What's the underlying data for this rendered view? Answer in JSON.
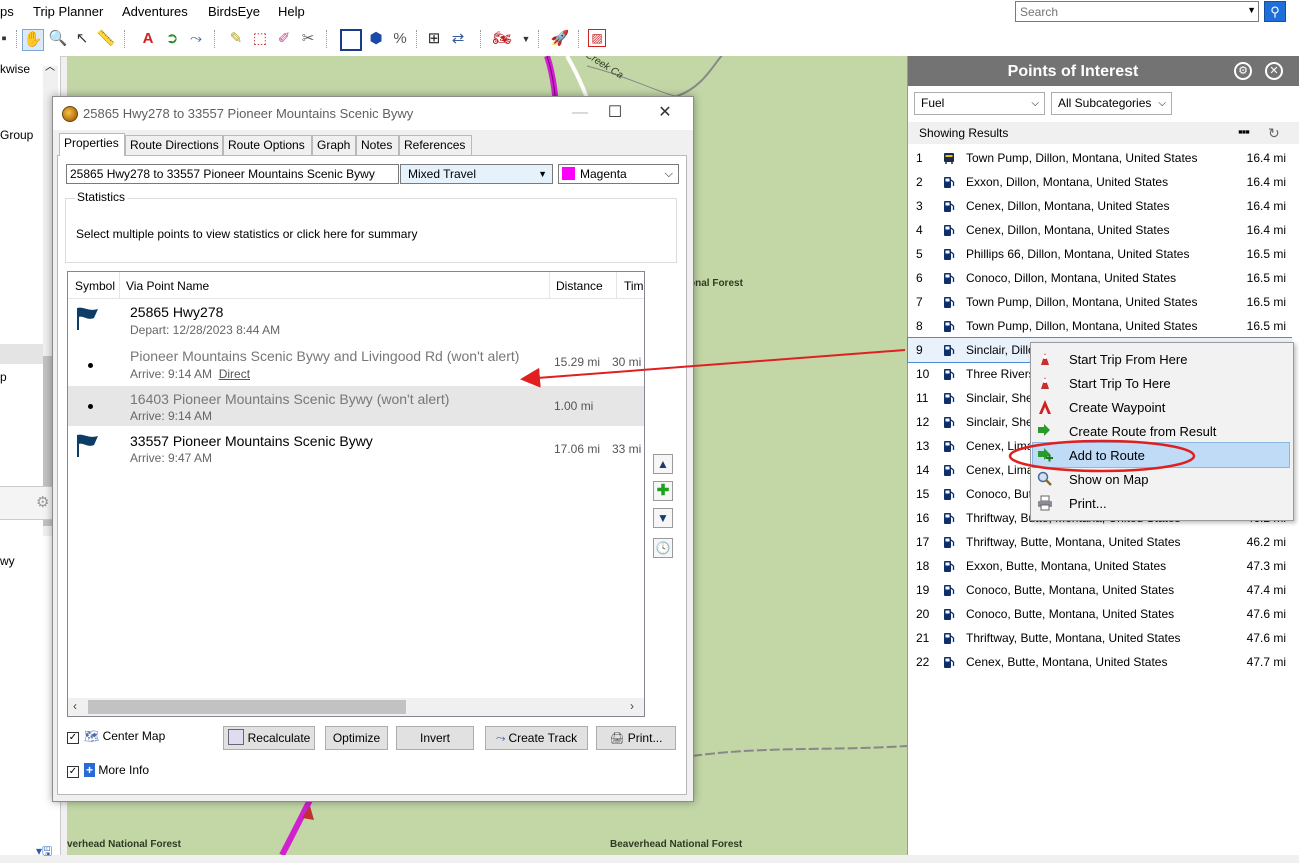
{
  "menu": {
    "items": [
      "ps",
      "Trip Planner",
      "Adventures",
      "BirdsEye",
      "Help"
    ]
  },
  "search": {
    "placeholder": "Search"
  },
  "left_panel": {
    "texts": [
      "kwise",
      "Group",
      "p",
      "wy"
    ]
  },
  "map": {
    "labels": [
      "onal Forest",
      "verhead National Forest",
      "Beaverhead National Forest",
      "Creek Ca"
    ]
  },
  "dialog": {
    "title": "25865 Hwy278 to 33557 Pioneer Mountains Scenic Bywy",
    "tabs": [
      "Properties",
      "Route Directions",
      "Route Options",
      "Graph",
      "Notes",
      "References"
    ],
    "route_name": "25865 Hwy278 to 33557 Pioneer Mountains Scenic Bywy",
    "travel_mode": "Mixed Travel",
    "color": {
      "label": "Magenta",
      "swatch": "#ff00ff"
    },
    "statistics": {
      "legend": "Statistics",
      "text": "Select multiple points to view statistics or click here for summary"
    },
    "columns": [
      "Symbol",
      "Via Point Name",
      "Distance",
      "Tim"
    ],
    "via_points": [
      {
        "symbol": "flag",
        "name": "25865 Hwy278",
        "sub": "Depart: 12/28/2023 8:44 AM",
        "distance": "",
        "time": ""
      },
      {
        "symbol": "bullet",
        "name": "Pioneer Mountains Scenic Bywy and Livingood Rd (won't alert)",
        "sub": "Arrive: 9:14 AM",
        "sub_link": "Direct",
        "distance": "15.29 mi",
        "time": "30 mi"
      },
      {
        "symbol": "bullet",
        "name": "16403 Pioneer Mountains Scenic Bywy (won't alert)",
        "sub": "Arrive: 9:14 AM",
        "distance": "1.00 mi",
        "time": ""
      },
      {
        "symbol": "flag",
        "name": "33557 Pioneer Mountains Scenic Bywy",
        "sub": "Arrive: 9:47 AM",
        "distance": "17.06 mi",
        "time": "33 mi"
      }
    ],
    "buttons": {
      "recalculate": "Recalculate",
      "optimize": "Optimize",
      "invert": "Invert",
      "create_track": "Create Track",
      "print": "Print..."
    },
    "checkboxes": {
      "center_map": "Center Map",
      "more_info": "More Info"
    }
  },
  "poi": {
    "title": "Points of Interest",
    "category": "Fuel",
    "subcategory": "All Subcategories",
    "showing": "Showing Results",
    "results": [
      {
        "n": "1",
        "name": "Town Pump, Dillon, Montana, United States",
        "dist": "16.4 mi",
        "icon": "bus-icon"
      },
      {
        "n": "2",
        "name": "Exxon, Dillon, Montana, United States",
        "dist": "16.4 mi",
        "icon": "fuel-icon"
      },
      {
        "n": "3",
        "name": "Cenex, Dillon, Montana, United States",
        "dist": "16.4 mi",
        "icon": "fuel-icon"
      },
      {
        "n": "4",
        "name": "Cenex, Dillon, Montana, United States",
        "dist": "16.4 mi",
        "icon": "fuel-icon"
      },
      {
        "n": "5",
        "name": "Phillips 66, Dillon, Montana, United States",
        "dist": "16.5 mi",
        "icon": "fuel-icon"
      },
      {
        "n": "6",
        "name": "Conoco, Dillon, Montana, United States",
        "dist": "16.5 mi",
        "icon": "fuel-icon"
      },
      {
        "n": "7",
        "name": "Town Pump, Dillon, Montana, United States",
        "dist": "16.5 mi",
        "icon": "fuel-icon"
      },
      {
        "n": "8",
        "name": "Town Pump, Dillon, Montana, United States",
        "dist": "16.5 mi",
        "icon": "fuel-icon"
      },
      {
        "n": "9",
        "name": "Sinclair, Dillo",
        "dist": "",
        "icon": "fuel-icon"
      },
      {
        "n": "10",
        "name": "Three Rivers",
        "dist": "",
        "icon": "fuel-icon"
      },
      {
        "n": "11",
        "name": "Sinclair, She",
        "dist": "",
        "icon": "fuel-icon"
      },
      {
        "n": "12",
        "name": "Sinclair, She",
        "dist": "",
        "icon": "fuel-icon"
      },
      {
        "n": "13",
        "name": "Cenex, Lima",
        "dist": "",
        "icon": "fuel-icon"
      },
      {
        "n": "14",
        "name": "Cenex, Lima",
        "dist": "",
        "icon": "fuel-icon"
      },
      {
        "n": "15",
        "name": "Conoco, But",
        "dist": "",
        "icon": "fuel-icon"
      },
      {
        "n": "16",
        "name": "Thriftway, Butte, Montana, United States",
        "dist": "46.2 mi",
        "icon": "fuel-icon"
      },
      {
        "n": "17",
        "name": "Thriftway, Butte, Montana, United States",
        "dist": "46.2 mi",
        "icon": "fuel-icon"
      },
      {
        "n": "18",
        "name": "Exxon, Butte, Montana, United States",
        "dist": "47.3 mi",
        "icon": "fuel-icon"
      },
      {
        "n": "19",
        "name": "Conoco, Butte, Montana, United States",
        "dist": "47.4 mi",
        "icon": "fuel-icon"
      },
      {
        "n": "20",
        "name": "Conoco, Butte, Montana, United States",
        "dist": "47.6 mi",
        "icon": "fuel-icon"
      },
      {
        "n": "21",
        "name": "Thriftway, Butte, Montana, United States",
        "dist": "47.6 mi",
        "icon": "fuel-icon"
      },
      {
        "n": "22",
        "name": "Cenex, Butte, Montana, United States",
        "dist": "47.7 mi",
        "icon": "fuel-icon"
      }
    ]
  },
  "context_menu": {
    "items": [
      {
        "label": "Start Trip From Here",
        "icon": "trip-start-icon"
      },
      {
        "label": "Start Trip To Here",
        "icon": "trip-end-icon"
      },
      {
        "label": "Create Waypoint",
        "icon": "waypoint-icon"
      },
      {
        "label": "Create Route from Result",
        "icon": "route-icon"
      },
      {
        "label": "Add to Route",
        "icon": "add-route-icon"
      },
      {
        "label": "Show on Map",
        "icon": "magnifier-icon"
      },
      {
        "label": "Print...",
        "icon": "printer-icon"
      }
    ],
    "highlighted": "Add to Route"
  },
  "annotation": {
    "arrow_color": "#e02020",
    "circle_color": "#e02020"
  }
}
